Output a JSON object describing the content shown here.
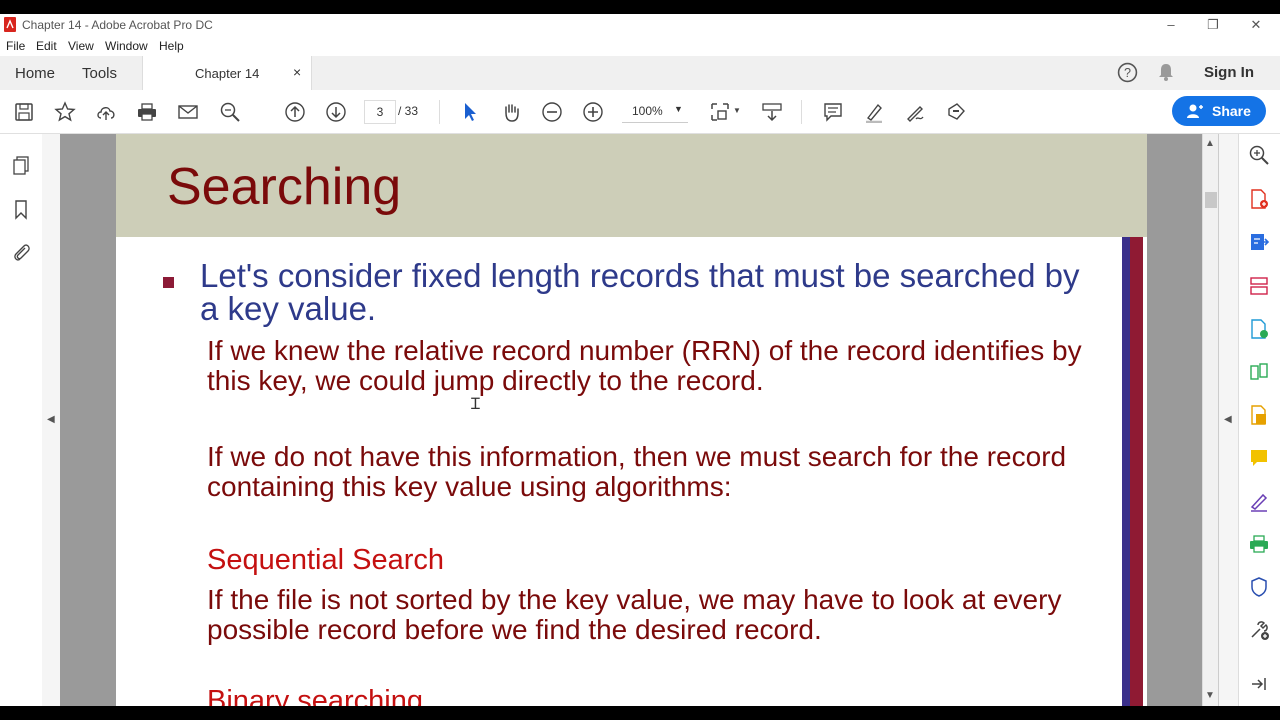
{
  "window": {
    "title": "Chapter 14 - Adobe Acrobat Pro DC",
    "minimize": "–",
    "restore": "❐",
    "close": "✕"
  },
  "menu": [
    "File",
    "Edit",
    "View",
    "Window",
    "Help"
  ],
  "tabs": {
    "home": "Home",
    "tools": "Tools",
    "document": "Chapter 14",
    "close": "×"
  },
  "header": {
    "signin": "Sign In"
  },
  "toolbar": {
    "page_current": "3",
    "page_total": "/ 33",
    "zoom": "100%",
    "share": "Share",
    "icons": [
      "save-icon",
      "bookmark-star-icon",
      "upload-cloud-icon",
      "print-icon",
      "email-icon",
      "search-zoom-icon",
      "page-up-icon",
      "page-down-icon",
      "select-arrow-icon",
      "hand-tool-icon",
      "zoom-out-icon",
      "zoom-in-icon",
      "page-fit-icon",
      "scroll-mode-icon",
      "comment-icon",
      "highlight-pen-icon",
      "sign-icon",
      "redact-stamp-icon"
    ]
  },
  "slide": {
    "title": "Searching",
    "bullet": "Let's consider fixed length records that must be searched by a key value.",
    "para1": "If we knew the relative record number (RRN) of the record identifies by this key, we could jump directly to the record.",
    "para2": "If we do not have this information, then we must search for the record containing this key value using algorithms:",
    "heading1": "Sequential Search",
    "para3": "If the file is not sorted by the key value, we may have to look at every possible record before we find the desired record.",
    "heading2": "Binary searching"
  },
  "colors": {
    "title": "#7a0a0a",
    "bullet_text": "#2e3a8a",
    "body": "#7a0a0a",
    "heading": "#c41010",
    "header_band": "#cdceb8",
    "share": "#1473e6"
  }
}
